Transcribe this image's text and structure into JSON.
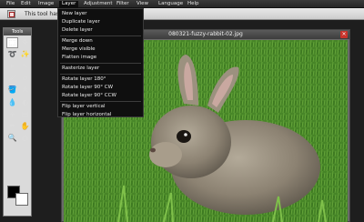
{
  "menubar": {
    "items": [
      {
        "label": "File"
      },
      {
        "label": "Edit"
      },
      {
        "label": "Image"
      },
      {
        "label": "Layer"
      },
      {
        "label": "Adjustment"
      },
      {
        "label": "Filter"
      },
      {
        "label": "View"
      },
      {
        "label": "Language"
      },
      {
        "label": "Help"
      }
    ],
    "active_index": 3
  },
  "options_bar": {
    "hint": "This tool has",
    "tool_icon": "marquee-select-icon"
  },
  "tools_panel": {
    "title": "Tools",
    "tools": [
      {
        "icon": "marquee-icon",
        "glyph": "⬚"
      },
      {
        "icon": "move-icon",
        "glyph": "✥"
      },
      {
        "icon": "lasso-icon",
        "glyph": "➰"
      },
      {
        "icon": "wand-icon",
        "glyph": "✨"
      },
      {
        "icon": "crop-icon",
        "glyph": "⌗"
      },
      {
        "icon": "pencil-icon",
        "glyph": "✎"
      },
      {
        "icon": "brush-icon",
        "glyph": "🖌"
      },
      {
        "icon": "eraser-icon",
        "glyph": "▱"
      },
      {
        "icon": "bucket-icon",
        "glyph": "🪣"
      },
      {
        "icon": "text-icon",
        "glyph": "A"
      },
      {
        "icon": "drop-icon",
        "glyph": "💧"
      },
      {
        "icon": "burn-icon",
        "glyph": "◐"
      },
      {
        "icon": "stamp-icon",
        "glyph": "⎈"
      },
      {
        "icon": "gradient-icon",
        "glyph": "▤"
      },
      {
        "icon": "eyedropper-icon",
        "glyph": "✒"
      },
      {
        "icon": "hand-icon",
        "glyph": "✋"
      },
      {
        "icon": "zoom-icon",
        "glyph": "🔍"
      },
      {
        "icon": "sponge-icon",
        "glyph": "◍"
      }
    ],
    "foreground_color": "#000000",
    "background_color": "#ffffff"
  },
  "image_window": {
    "title": "080321-fuzzy-rabbit-02.jpg",
    "close_glyph": "×"
  },
  "layer_menu": {
    "groups": [
      [
        "New layer",
        "Duplicate layer",
        "Delete layer"
      ],
      [
        "Merge down",
        "Merge visible",
        "Flatten image"
      ],
      [
        "Rasterize layer"
      ],
      [
        "Rotate layer 180°",
        "Rotate layer 90° CW",
        "Rotate layer 90° CCW"
      ],
      [
        "Flip layer vertical",
        "Flip layer horizontal"
      ]
    ]
  },
  "colors": {
    "menubar_bg": "#262626",
    "dropdown_bg": "#0f0f0f",
    "close_red": "#c8332b",
    "grass_green": "#4d8a2a"
  }
}
